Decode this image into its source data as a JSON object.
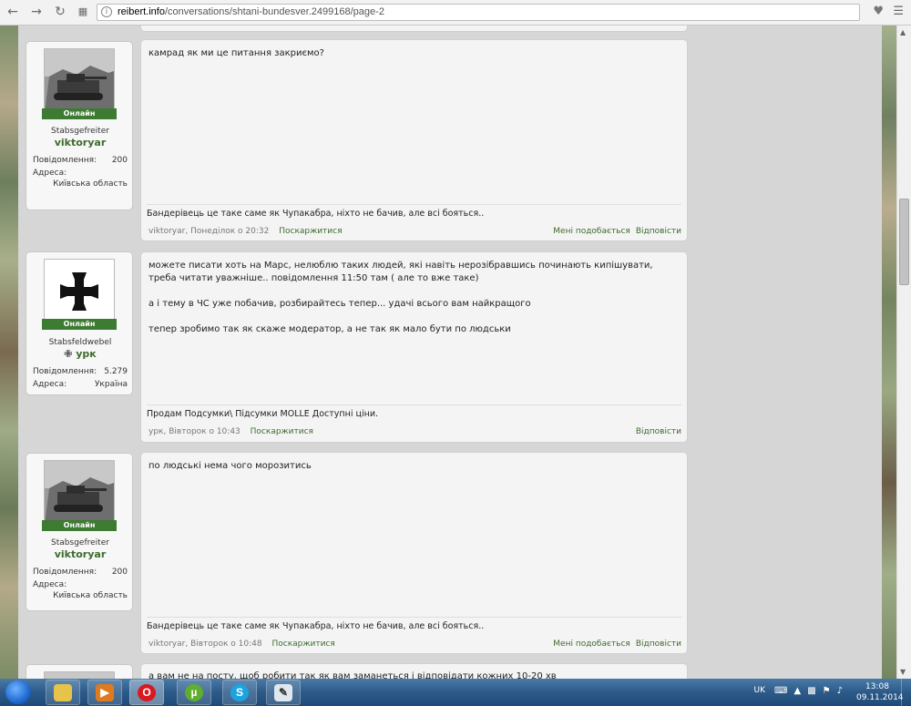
{
  "browser": {
    "url_host": "reibert.info",
    "url_path": "/conversations/shtani-bundesver.2499168/page-2"
  },
  "posts": [
    {
      "user": {
        "badge": "Онлайн",
        "rank": "Stabsgefreiter",
        "name": "viktoryar",
        "stats": [
          {
            "k": "Повідомлення:",
            "v": "200"
          },
          {
            "k": "Адреса:",
            "v": "Київська область"
          }
        ]
      },
      "paragraphs": [
        "камрад як ми це питання закриємо?"
      ],
      "signature": "Бандерівець це таке саме як Чупакабра, ніхто не бачив, але всі бояться..",
      "meta": {
        "author": "viktoryar",
        "date": "Понеділок о 20:32",
        "report": "Поскаржитися",
        "like": "Мені подобається",
        "reply": "Відповісти"
      }
    },
    {
      "user": {
        "badge": "Онлайн",
        "rank": "Stabsfeldwebel",
        "name": "урк",
        "stats": [
          {
            "k": "Повідомлення:",
            "v": "5.279"
          },
          {
            "k": "Адреса:",
            "v": "Україна"
          }
        ]
      },
      "paragraphs": [
        "можете писати хоть на Марс, нелюблю таких людей, які навіть нерозібравшись починають кипішувати, треба читати уважніше.. повідомлення 11:50 там ( але то вже таке)",
        "а і тему в ЧС уже побачив, розбирайтесь тепер... удачі всього вам найкращого",
        "тепер зробимо так як скаже модератор, а не так як мало бути по людськи"
      ],
      "signature": "Продам Подсумки\\ Підсумки MOLLE Доступні ціни.",
      "meta": {
        "author": "урк",
        "date": "Вівторок о 10:43",
        "report": "Поскаржитися",
        "reply": "Відповісти"
      }
    },
    {
      "user": {
        "badge": "Онлайн",
        "rank": "Stabsgefreiter",
        "name": "viktoryar",
        "stats": [
          {
            "k": "Повідомлення:",
            "v": "200"
          },
          {
            "k": "Адреса:",
            "v": "Київська область"
          }
        ]
      },
      "paragraphs": [
        "по людські нема чого морозитись"
      ],
      "signature": "Бандерівець це таке саме як Чупакабра, ніхто не бачив, але всі бояться..",
      "meta": {
        "author": "viktoryar",
        "date": "Вівторок о 10:48",
        "report": "Поскаржитися",
        "like": "Мені подобається",
        "reply": "Відповісти"
      }
    },
    {
      "paragraphs": [
        "а вам не на посту, щоб робити так як вам заманеться і відповідати кожних 10-20 хв"
      ]
    }
  ],
  "taskbar": {
    "lang": "UK",
    "time": "13:08",
    "date": "09.11.2014"
  }
}
